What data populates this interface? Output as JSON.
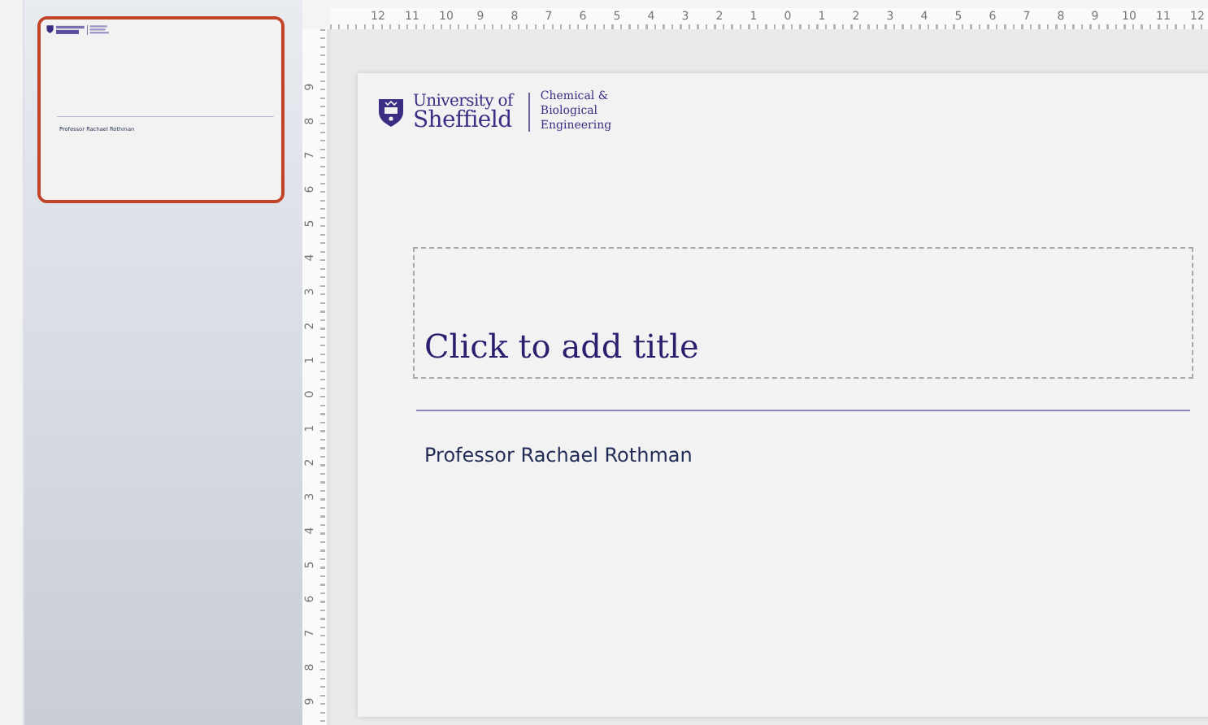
{
  "slides_panel": {
    "thumbnails": [
      {
        "selected": true,
        "subtitle": "Professor Rachael Rothman"
      }
    ]
  },
  "top_ruler": {
    "labels": [
      "12",
      "11",
      "10",
      "9",
      "8",
      "7",
      "6",
      "5",
      "4",
      "3",
      "2",
      "1",
      "0",
      "1",
      "2",
      "3",
      "4",
      "5",
      "6",
      "7",
      "8",
      "9",
      "10",
      "11",
      "12"
    ]
  },
  "side_ruler": {
    "labels": [
      "9",
      "8",
      "7",
      "6",
      "5",
      "4",
      "3",
      "2",
      "1",
      "0",
      "1",
      "2",
      "3",
      "4",
      "5",
      "6",
      "7",
      "8",
      "9"
    ]
  },
  "slide": {
    "logo": {
      "lines": [
        "University of",
        "Sheffield"
      ],
      "department": [
        "Chemical &",
        "Biological",
        "Engineering"
      ]
    },
    "title_placeholder": "Click to add title",
    "subtitle": "Professor Rachael Rothman"
  }
}
